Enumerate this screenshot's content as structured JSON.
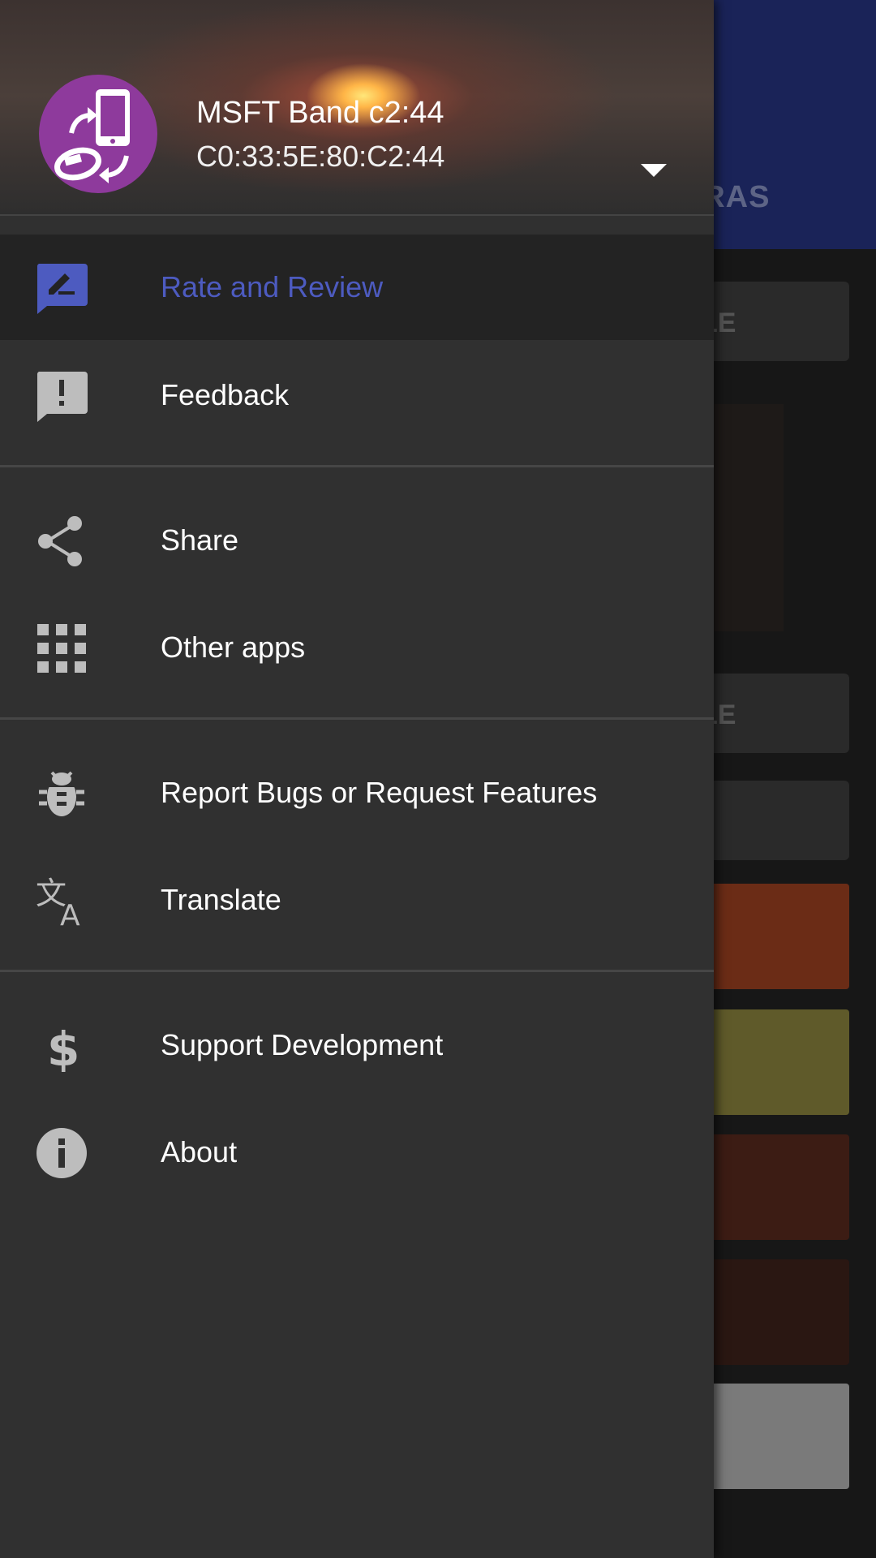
{
  "background_app": {
    "tab_label": "TRAS",
    "card_labels": [
      "LE",
      "LE"
    ],
    "swatch_colors": [
      "#6b2c16",
      "#5f5a2a",
      "#3c1c14",
      "#2a1712",
      "#7a7a7a"
    ]
  },
  "drawer": {
    "account": {
      "name": "MSFT Band c2:44",
      "address": "C0:33:5E:80:C2:44",
      "avatar_color": "#8e3a9c"
    },
    "accent_color": "#4d5bc0",
    "sections": [
      {
        "items": [
          {
            "label": "Rate and Review",
            "icon": "rate-review-icon",
            "selected": true
          },
          {
            "label": "Feedback",
            "icon": "feedback-icon",
            "selected": false
          }
        ]
      },
      {
        "items": [
          {
            "label": "Share",
            "icon": "share-icon",
            "selected": false
          },
          {
            "label": "Other apps",
            "icon": "apps-grid-icon",
            "selected": false
          }
        ]
      },
      {
        "items": [
          {
            "label": "Report Bugs or Request Features",
            "icon": "bug-icon",
            "selected": false
          },
          {
            "label": "Translate",
            "icon": "translate-icon",
            "selected": false
          }
        ]
      },
      {
        "items": [
          {
            "label": "Support Development",
            "icon": "dollar-icon",
            "selected": false
          },
          {
            "label": "About",
            "icon": "info-icon",
            "selected": false
          }
        ]
      }
    ]
  }
}
